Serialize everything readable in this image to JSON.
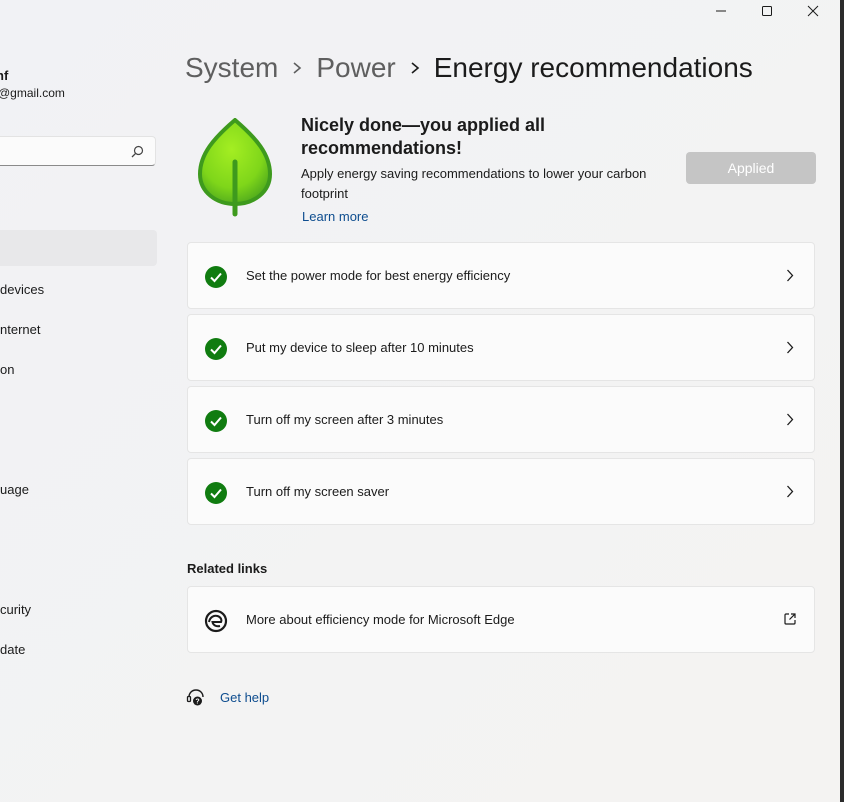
{
  "window": {
    "minimize_icon": "minimize-icon",
    "maximize_icon": "maximize-icon",
    "close_icon": "close-icon"
  },
  "sidebar": {
    "user_name": "nf",
    "user_email": "@gmail.com",
    "search": {
      "placeholder": "",
      "icon": "search-icon"
    },
    "items": [
      {
        "label": ""
      },
      {
        "label": "devices"
      },
      {
        "label": "nternet"
      },
      {
        "label": "on"
      },
      {
        "label": "uage"
      },
      {
        "label": "curity"
      },
      {
        "label": "date"
      }
    ]
  },
  "breadcrumb": {
    "items": [
      "System",
      "Power"
    ],
    "current": "Energy recommendations"
  },
  "hero": {
    "icon": "leaf-icon",
    "title": "Nicely done—you applied all recommendations!",
    "description": "Apply energy saving recommendations to lower your carbon footprint",
    "learn_more": "Learn more",
    "button_label": "Applied"
  },
  "recommendations": [
    {
      "label": "Set the power mode for best energy efficiency",
      "status": "applied"
    },
    {
      "label": "Put my device to sleep after 10 minutes",
      "status": "applied"
    },
    {
      "label": "Turn off my screen after 3 minutes",
      "status": "applied"
    },
    {
      "label": "Turn off my screen saver",
      "status": "applied"
    }
  ],
  "related": {
    "heading": "Related links",
    "items": [
      {
        "label": "More about efficiency mode for Microsoft Edge",
        "icon": "edge-icon"
      }
    ]
  },
  "help": {
    "label": "Get help",
    "icon": "help-icon"
  },
  "colors": {
    "accent_green": "#107c10",
    "leaf_light": "#8fe01a",
    "leaf_dark": "#3f9b1e",
    "link": "#0e4d8f",
    "applied_button": "#c5c5c5"
  }
}
